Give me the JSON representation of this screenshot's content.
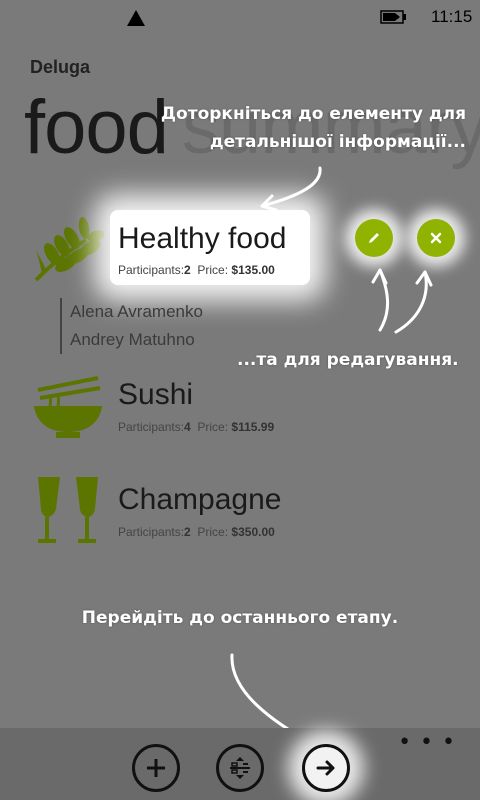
{
  "status_bar": {
    "time": "11:15"
  },
  "app_title": "Deluga",
  "pivot": {
    "active": "food",
    "inactive": "summary"
  },
  "labels": {
    "participants": "Participants:",
    "price": "Price:"
  },
  "items": [
    {
      "name": "Healthy food",
      "participants": "2",
      "price": "$135.00",
      "icon": "wheat-icon"
    },
    {
      "name": "Sushi",
      "participants": "4",
      "price": "$115.99",
      "icon": "noodle-bowl-icon"
    },
    {
      "name": "Champagne",
      "participants": "2",
      "price": "$350.00",
      "icon": "champagne-glasses-icon"
    }
  ],
  "participants_list": [
    "Alena Avramenko",
    "Andrey Matuhno"
  ],
  "hints": {
    "tap_line1": "Доторкніться до елементу для",
    "tap_line2": "детальнішої інформації...",
    "edit": "...та для редагування.",
    "next": "Перейдіть до останнього етапу."
  },
  "app_bar": {
    "more": "• • •"
  },
  "colors": {
    "accent": "#8fb300",
    "overlay": "#7a7a7a",
    "app_bar": "#6a6a6a"
  }
}
